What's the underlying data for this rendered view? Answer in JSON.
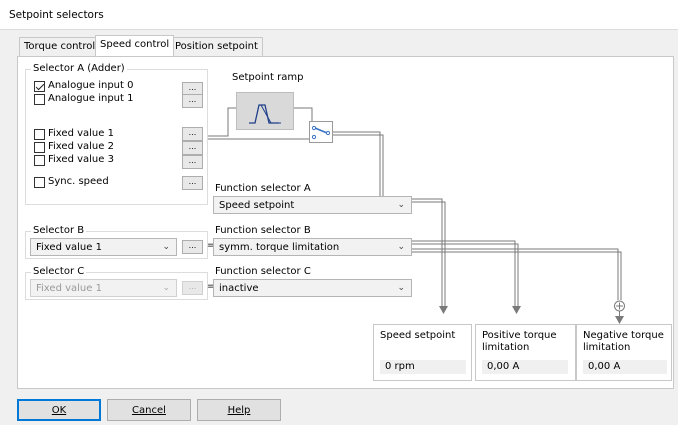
{
  "window": {
    "title": "Setpoint selectors"
  },
  "tabs": [
    {
      "label": "Torque control",
      "active": false
    },
    {
      "label": "Speed control",
      "active": true
    },
    {
      "label": "Position setpoint",
      "active": false
    }
  ],
  "selector_a": {
    "legend": "Selector A (Adder)",
    "items": [
      {
        "label": "Analogue input 0",
        "checked": true
      },
      {
        "label": "Analogue input 1",
        "checked": false
      },
      {
        "label": "Fixed value 1",
        "checked": false
      },
      {
        "label": "Fixed value 2",
        "checked": false
      },
      {
        "label": "Fixed value 3",
        "checked": false
      },
      {
        "label": "Sync. speed",
        "checked": false
      }
    ],
    "dots": "..."
  },
  "setpoint_ramp": {
    "label": "Setpoint ramp"
  },
  "function_selector_a": {
    "label": "Function selector A",
    "value": "Speed setpoint"
  },
  "selector_b": {
    "legend": "Selector B",
    "value": "Fixed value 1"
  },
  "function_selector_b": {
    "label": "Function selector B",
    "value": "symm. torque limitation"
  },
  "selector_c": {
    "legend": "Selector C",
    "value": "Fixed value 1",
    "disabled": true
  },
  "function_selector_c": {
    "label": "Function selector C",
    "value": "inactive"
  },
  "equals": "=",
  "outputs": [
    {
      "title": "Speed setpoint",
      "value": "0  rpm"
    },
    {
      "title": "Positive torque limitation",
      "value": "0,00 A"
    },
    {
      "title": "Negative torque limitation",
      "value": "0,00 A"
    }
  ],
  "buttons": {
    "ok": "OK",
    "cancel": "Cancel",
    "help": "Help"
  },
  "colors": {
    "line": "#7a7a7a",
    "ramp_box": "#d9d9d9",
    "ramp_glyph": "#1f3f8a",
    "switch": "#3a72c4"
  }
}
